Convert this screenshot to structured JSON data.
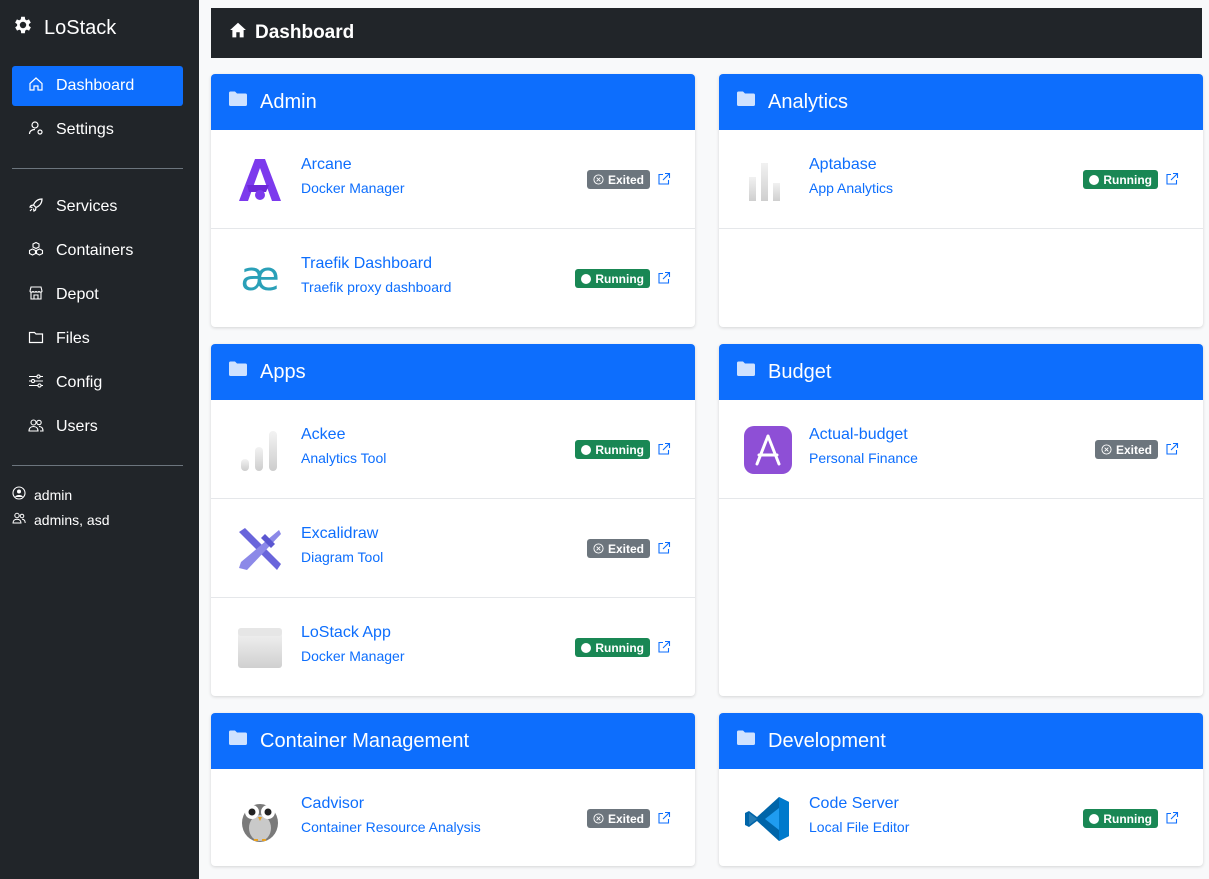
{
  "brand": {
    "name": "LoStack",
    "icon": "gear-icon"
  },
  "nav_primary": [
    {
      "label": "Dashboard",
      "icon": "house-icon",
      "active": true
    },
    {
      "label": "Settings",
      "icon": "user-gear-icon",
      "active": false
    }
  ],
  "nav_secondary": [
    {
      "label": "Services",
      "icon": "rocket-icon"
    },
    {
      "label": "Containers",
      "icon": "boxes-icon"
    },
    {
      "label": "Depot",
      "icon": "shop-icon"
    },
    {
      "label": "Files",
      "icon": "folder-icon"
    },
    {
      "label": "Config",
      "icon": "sliders-icon"
    },
    {
      "label": "Users",
      "icon": "people-icon"
    }
  ],
  "user": {
    "name": "admin",
    "groups": "admins, asd"
  },
  "header": {
    "title": "Dashboard",
    "icon": "house-fill-icon"
  },
  "colors": {
    "primary": "#0d6efd",
    "dark": "#212529",
    "running": "#198754",
    "exited": "#6c757d"
  },
  "groups": [
    {
      "title": "Admin",
      "services": [
        {
          "name": "Arcane",
          "desc": "Docker Manager",
          "status": "Exited",
          "icon": "arcane-logo"
        },
        {
          "name": "Traefik Dashboard",
          "desc": "Traefik proxy dashboard",
          "status": "Running",
          "icon": "traefik-logo"
        }
      ]
    },
    {
      "title": "Analytics",
      "services": [
        {
          "name": "Aptabase",
          "desc": "App Analytics",
          "status": "Running",
          "icon": "aptabase-logo"
        }
      ]
    },
    {
      "title": "Apps",
      "services": [
        {
          "name": "Ackee",
          "desc": "Analytics Tool",
          "status": "Running",
          "icon": "ackee-logo"
        },
        {
          "name": "Excalidraw",
          "desc": "Diagram Tool",
          "status": "Exited",
          "icon": "excalidraw-logo"
        },
        {
          "name": "LoStack App",
          "desc": "Docker Manager",
          "status": "Running",
          "icon": "lostack-app-logo"
        }
      ]
    },
    {
      "title": "Budget",
      "services": [
        {
          "name": "Actual-budget",
          "desc": "Personal Finance",
          "status": "Exited",
          "icon": "actual-budget-logo"
        }
      ]
    },
    {
      "title": "Container Management",
      "services": [
        {
          "name": "Cadvisor",
          "desc": "Container Resource Analysis",
          "status": "Exited",
          "icon": "cadvisor-owl-logo"
        }
      ]
    },
    {
      "title": "Development",
      "services": [
        {
          "name": "Code Server",
          "desc": "Local File Editor",
          "status": "Running",
          "icon": "vscode-logo"
        }
      ]
    }
  ]
}
